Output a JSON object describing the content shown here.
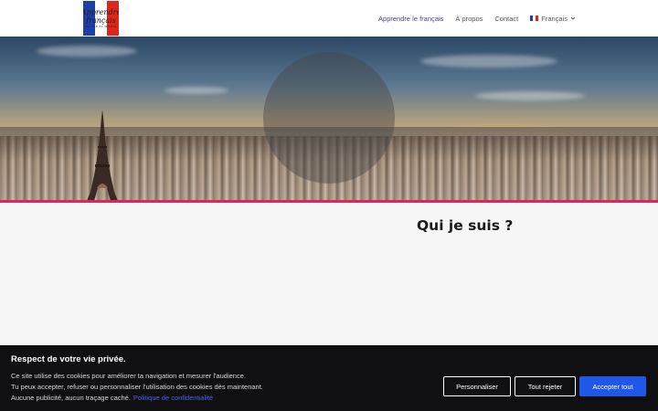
{
  "header": {
    "logo": {
      "line1": "Apprendre",
      "line2": "français",
      "line3": "FACILE ET MOINS"
    },
    "nav": [
      {
        "label": "Apprendre le français",
        "active": true
      },
      {
        "label": "À propos",
        "active": false
      },
      {
        "label": "Contact",
        "active": false
      }
    ],
    "language": {
      "label": "Français",
      "flag_colors": [
        "#1e3fa8",
        "#ffffff",
        "#e1251b"
      ]
    }
  },
  "hero": {
    "accent_bar_color": "#e0245e"
  },
  "content": {
    "title": "Qui je suis ?"
  },
  "cookie_banner": {
    "title": "Respect de votre vie privée.",
    "line1": "Ce site utilise des cookies pour améliorer ta navigation et mesurer l'audience.",
    "line2": "Tu peux accepter, refuser ou personnaliser l'utilisation des cookies dès maintenant.",
    "line3": "Aucune publicité, aucun traçage caché.",
    "policy_link": "Politique de confidentialité",
    "buttons": {
      "customize": "Personnaliser",
      "reject": "Tout rejeter",
      "accept": "Accepter tout"
    },
    "accept_color": "#1f57e6"
  }
}
